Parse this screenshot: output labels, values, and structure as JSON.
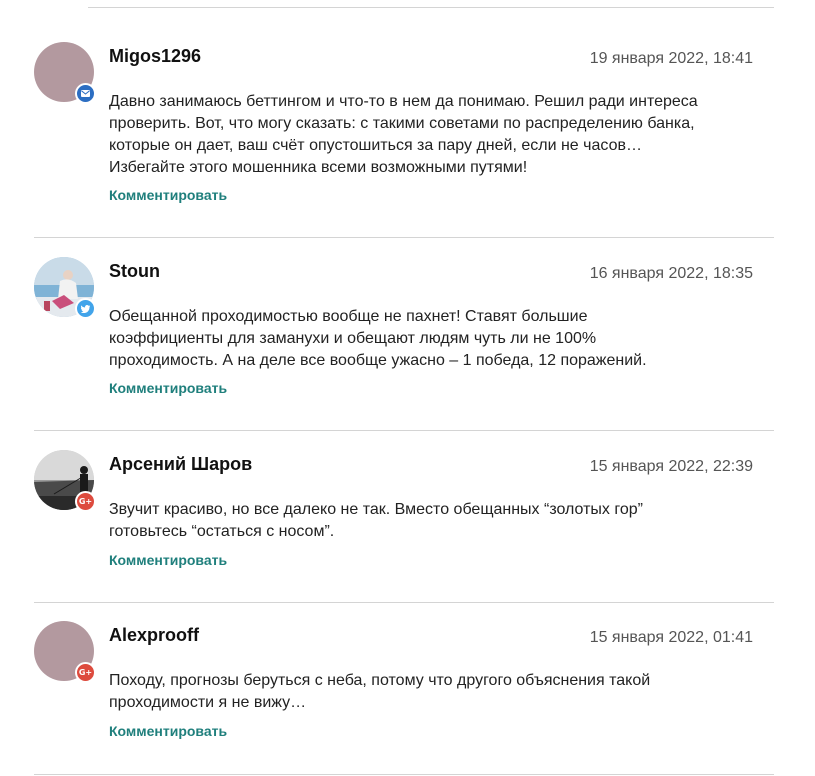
{
  "reply_label": "Комментировать",
  "colors": {
    "reply_link": "#1f7f7c",
    "avatar_placeholder": "#b3999f",
    "badge_mail": "#2c6ec2",
    "badge_twitter": "#42a4ea",
    "badge_gplus": "#dd4b3e"
  },
  "comments": [
    {
      "author": "Migos1296",
      "date": "19 января 2022, 18:41",
      "badge_icon": "mail-icon",
      "avatar_type": "placeholder",
      "lines": [
        "Давно занимаюсь беттингом и что-то в нем да понимаю. Решил ради интереса",
        "проверить. Вот, что могу сказать: с такими советами по распределению банка,",
        "которые он дает, ваш счёт опустошиться за пару дней, если не часов…",
        "Избегайте этого мошенника всеми возможными путями!"
      ]
    },
    {
      "author": "Stoun",
      "date": "16 января 2022, 18:35",
      "badge_icon": "twitter-icon",
      "avatar_type": "photo",
      "lines": [
        "Обещанной проходимостью вообще не пахнет! Ставят большие",
        "коэффициенты для заманухи и обещают людям чуть ли не 100%",
        "проходимость. А на деле все вообще ужасно – 1 победа, 12 поражений."
      ]
    },
    {
      "author": "Арсений Шаров",
      "date": "15 января 2022, 22:39",
      "badge_icon": "google-plus-icon",
      "avatar_type": "photo",
      "lines": [
        "Звучит красиво, но все далеко не так. Вместо обещанных “золотых гор”",
        "готовьтесь “остаться с носом”."
      ]
    },
    {
      "author": "Alexprooff",
      "date": "15 января 2022, 01:41",
      "badge_icon": "google-plus-icon",
      "avatar_type": "placeholder",
      "lines": [
        "Походу, прогнозы беруться с неба, потому что другого объяснения такой",
        "проходимости я не вижу…"
      ]
    }
  ]
}
